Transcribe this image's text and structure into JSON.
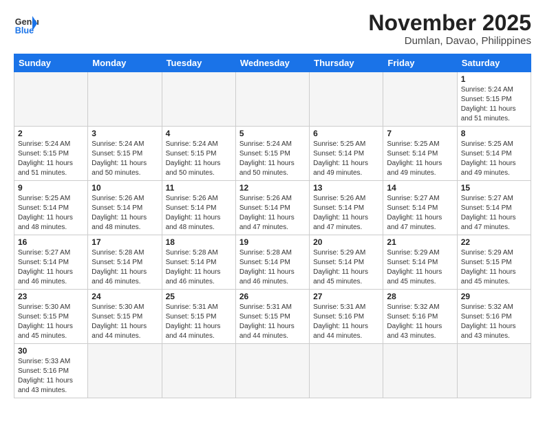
{
  "header": {
    "logo_general": "General",
    "logo_blue": "Blue",
    "month_title": "November 2025",
    "location": "Dumlan, Davao, Philippines"
  },
  "weekdays": [
    "Sunday",
    "Monday",
    "Tuesday",
    "Wednesday",
    "Thursday",
    "Friday",
    "Saturday"
  ],
  "weeks": [
    [
      {
        "day": "",
        "info": ""
      },
      {
        "day": "",
        "info": ""
      },
      {
        "day": "",
        "info": ""
      },
      {
        "day": "",
        "info": ""
      },
      {
        "day": "",
        "info": ""
      },
      {
        "day": "",
        "info": ""
      },
      {
        "day": "1",
        "info": "Sunrise: 5:24 AM\nSunset: 5:15 PM\nDaylight: 11 hours\nand 51 minutes."
      }
    ],
    [
      {
        "day": "2",
        "info": "Sunrise: 5:24 AM\nSunset: 5:15 PM\nDaylight: 11 hours\nand 51 minutes."
      },
      {
        "day": "3",
        "info": "Sunrise: 5:24 AM\nSunset: 5:15 PM\nDaylight: 11 hours\nand 50 minutes."
      },
      {
        "day": "4",
        "info": "Sunrise: 5:24 AM\nSunset: 5:15 PM\nDaylight: 11 hours\nand 50 minutes."
      },
      {
        "day": "5",
        "info": "Sunrise: 5:24 AM\nSunset: 5:15 PM\nDaylight: 11 hours\nand 50 minutes."
      },
      {
        "day": "6",
        "info": "Sunrise: 5:25 AM\nSunset: 5:14 PM\nDaylight: 11 hours\nand 49 minutes."
      },
      {
        "day": "7",
        "info": "Sunrise: 5:25 AM\nSunset: 5:14 PM\nDaylight: 11 hours\nand 49 minutes."
      },
      {
        "day": "8",
        "info": "Sunrise: 5:25 AM\nSunset: 5:14 PM\nDaylight: 11 hours\nand 49 minutes."
      }
    ],
    [
      {
        "day": "9",
        "info": "Sunrise: 5:25 AM\nSunset: 5:14 PM\nDaylight: 11 hours\nand 48 minutes."
      },
      {
        "day": "10",
        "info": "Sunrise: 5:26 AM\nSunset: 5:14 PM\nDaylight: 11 hours\nand 48 minutes."
      },
      {
        "day": "11",
        "info": "Sunrise: 5:26 AM\nSunset: 5:14 PM\nDaylight: 11 hours\nand 48 minutes."
      },
      {
        "day": "12",
        "info": "Sunrise: 5:26 AM\nSunset: 5:14 PM\nDaylight: 11 hours\nand 47 minutes."
      },
      {
        "day": "13",
        "info": "Sunrise: 5:26 AM\nSunset: 5:14 PM\nDaylight: 11 hours\nand 47 minutes."
      },
      {
        "day": "14",
        "info": "Sunrise: 5:27 AM\nSunset: 5:14 PM\nDaylight: 11 hours\nand 47 minutes."
      },
      {
        "day": "15",
        "info": "Sunrise: 5:27 AM\nSunset: 5:14 PM\nDaylight: 11 hours\nand 47 minutes."
      }
    ],
    [
      {
        "day": "16",
        "info": "Sunrise: 5:27 AM\nSunset: 5:14 PM\nDaylight: 11 hours\nand 46 minutes."
      },
      {
        "day": "17",
        "info": "Sunrise: 5:28 AM\nSunset: 5:14 PM\nDaylight: 11 hours\nand 46 minutes."
      },
      {
        "day": "18",
        "info": "Sunrise: 5:28 AM\nSunset: 5:14 PM\nDaylight: 11 hours\nand 46 minutes."
      },
      {
        "day": "19",
        "info": "Sunrise: 5:28 AM\nSunset: 5:14 PM\nDaylight: 11 hours\nand 46 minutes."
      },
      {
        "day": "20",
        "info": "Sunrise: 5:29 AM\nSunset: 5:14 PM\nDaylight: 11 hours\nand 45 minutes."
      },
      {
        "day": "21",
        "info": "Sunrise: 5:29 AM\nSunset: 5:14 PM\nDaylight: 11 hours\nand 45 minutes."
      },
      {
        "day": "22",
        "info": "Sunrise: 5:29 AM\nSunset: 5:15 PM\nDaylight: 11 hours\nand 45 minutes."
      }
    ],
    [
      {
        "day": "23",
        "info": "Sunrise: 5:30 AM\nSunset: 5:15 PM\nDaylight: 11 hours\nand 45 minutes."
      },
      {
        "day": "24",
        "info": "Sunrise: 5:30 AM\nSunset: 5:15 PM\nDaylight: 11 hours\nand 44 minutes."
      },
      {
        "day": "25",
        "info": "Sunrise: 5:31 AM\nSunset: 5:15 PM\nDaylight: 11 hours\nand 44 minutes."
      },
      {
        "day": "26",
        "info": "Sunrise: 5:31 AM\nSunset: 5:15 PM\nDaylight: 11 hours\nand 44 minutes."
      },
      {
        "day": "27",
        "info": "Sunrise: 5:31 AM\nSunset: 5:16 PM\nDaylight: 11 hours\nand 44 minutes."
      },
      {
        "day": "28",
        "info": "Sunrise: 5:32 AM\nSunset: 5:16 PM\nDaylight: 11 hours\nand 43 minutes."
      },
      {
        "day": "29",
        "info": "Sunrise: 5:32 AM\nSunset: 5:16 PM\nDaylight: 11 hours\nand 43 minutes."
      }
    ],
    [
      {
        "day": "30",
        "info": "Sunrise: 5:33 AM\nSunset: 5:16 PM\nDaylight: 11 hours\nand 43 minutes."
      },
      {
        "day": "",
        "info": ""
      },
      {
        "day": "",
        "info": ""
      },
      {
        "day": "",
        "info": ""
      },
      {
        "day": "",
        "info": ""
      },
      {
        "day": "",
        "info": ""
      },
      {
        "day": "",
        "info": ""
      }
    ]
  ]
}
